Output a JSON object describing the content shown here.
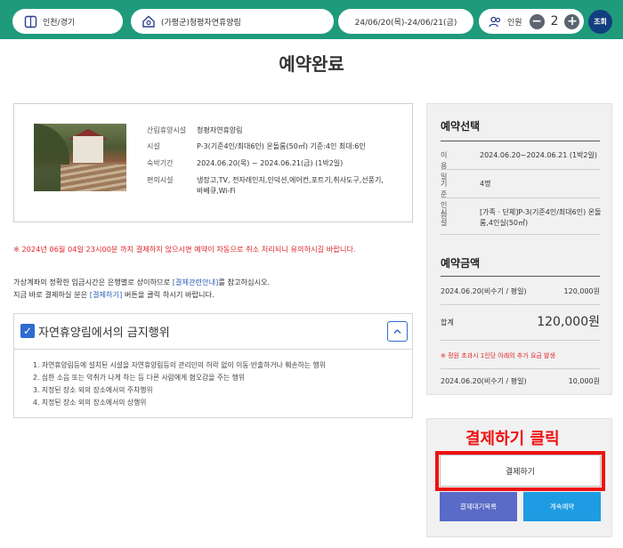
{
  "top_bar": {
    "region": "인천/경기",
    "forest": "(가평군)청평자연휴양림",
    "dates": "24/06/20(목)-24/06/21(금)",
    "people_label": "인원",
    "minus": "−",
    "plus": "+",
    "people_count": "2",
    "search_label": "조회",
    "color": "#1f9b7c"
  },
  "page_title": "예약완료",
  "reservation": {
    "rows": [
      {
        "label": "산림휴양시설",
        "value": "청평자연휴양림"
      },
      {
        "label": "시설",
        "value": "P-3(기준4인/최대6인) 온돌룸(50㎡) 기준:4인 최대:6인"
      },
      {
        "label": "숙박기간",
        "value": "2024.06.20(목) ~ 2024.06.21(금) (1박2일)"
      },
      {
        "label": "편의시설",
        "value": "냉장고,TV, 전자레인지,인덕션,에어컨,포트기,취사도구,선풍기,바베큐,Wi-Fi"
      }
    ]
  },
  "warning": "※ 2024년 06월 04일 23시00분 까지 결제하지 않으시면 예약이 자동으로 취소 처리되니 유의하시길 바랍니다.",
  "notice": {
    "line1_pre": "가상계좌의 정확한 입금시간은 은행별로 상이하므로 ",
    "line1_link": "[결제관련안내]",
    "line1_post": "를 참고하십시오.",
    "line2_pre": "지금 바로 결제하실 분은 ",
    "line2_link": "[결제하기]",
    "line2_post": " 버튼을 클릭 하시기 바랍니다."
  },
  "prohibited": {
    "title": "자연휴양림에서의 금지행위",
    "toggle_glyph": "^",
    "items": [
      "1. 자연휴양림등에 설치된 시설을 자연휴양림등의 관리인의 허락 없이 이동·반출하거나 훼손하는 행위",
      "2. 심한 소음 또는 악취가 나게 하는 등 다른 사람에게 혐오감을 주는 행위",
      "3. 지정된 장소 외의 장소에서의 주차행위",
      "4. 지정된 장소 외의 장소에서의 상행위"
    ]
  },
  "selection": {
    "title": "예약선택",
    "period_label": "이용일",
    "period_value": "2024.06.20~2024.06.21 (1박2일)",
    "people_label": "기준인원",
    "people_value": "4명",
    "facility_label": "시설",
    "facility_value": "[가족 · 단체]P-3(기준4인/최대6인) 온돌룸,4인실(50㎡)"
  },
  "amount": {
    "title": "예약금액",
    "line1_label": "2024.06.20(비수기 / 평일)",
    "line1_value": "120,000원",
    "total_label": "합계",
    "total_value": "120,000원",
    "extra_note": "※ 정원 초과시 1인당 아래의 추가 요금 발생",
    "extra_label": "2024.06.20(비수기 / 평일)",
    "extra_value": "10,000원"
  },
  "payment": {
    "annotation": "결제하기 클릭",
    "pay_label": "결제하기",
    "pending_label": "결제대기목록",
    "continue_label": "계속예약",
    "highlight_color": "#ee1111"
  }
}
